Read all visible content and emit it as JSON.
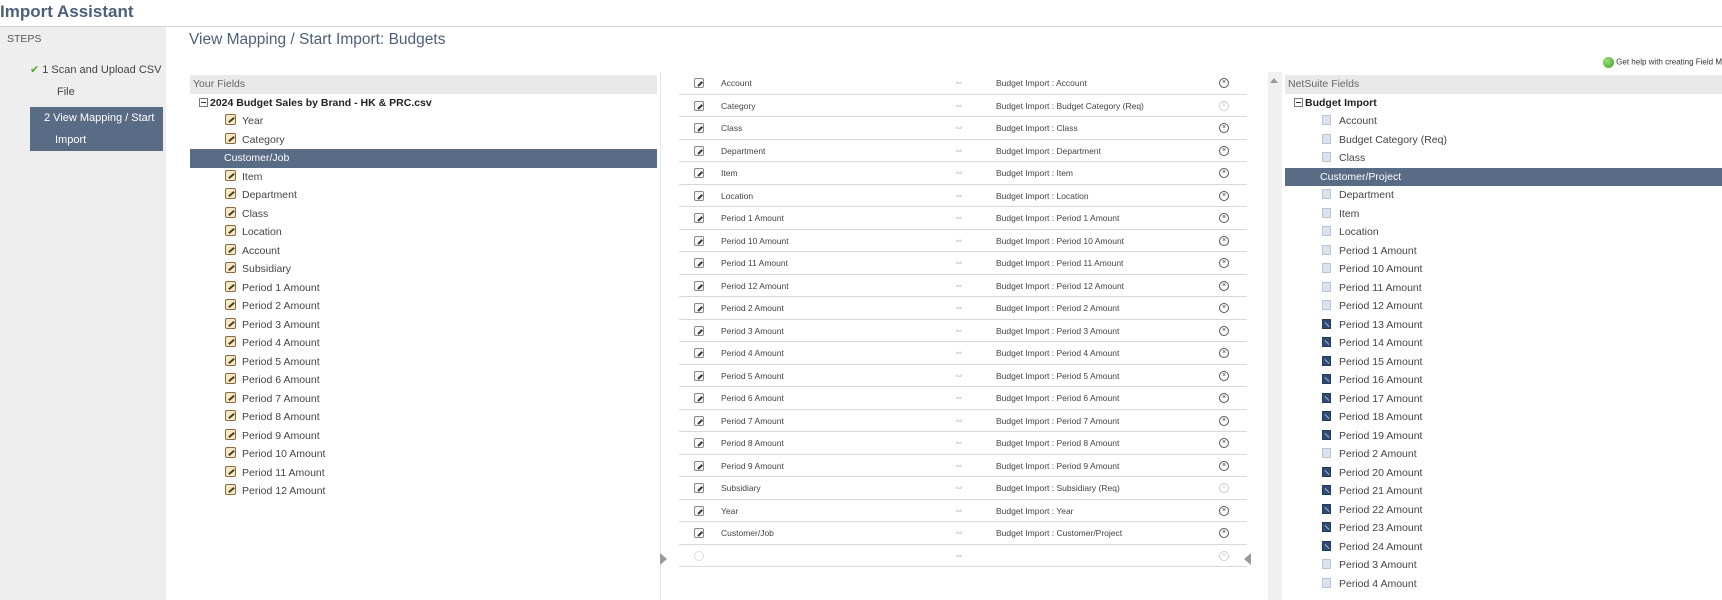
{
  "app": {
    "title": "Import Assistant"
  },
  "steps": {
    "label": "STEPS",
    "step1": {
      "line1": "1 Scan and Upload CSV",
      "line2": "File",
      "done_mark": "✔"
    },
    "step2": {
      "line1": "2 View Mapping / Start",
      "line2": "Import"
    }
  },
  "section_title": "View Mapping / Start Import: Budgets",
  "help_link": "Get help with creating Field M",
  "your_fields": {
    "header": "Your Fields",
    "root": "2024 Budget Sales by Brand - HK & PRC.csv",
    "items": [
      {
        "label": "Year"
      },
      {
        "label": "Category"
      },
      {
        "label": "Customer/Job",
        "selected": true
      },
      {
        "label": "Item"
      },
      {
        "label": "Department"
      },
      {
        "label": "Class"
      },
      {
        "label": "Location"
      },
      {
        "label": "Account"
      },
      {
        "label": "Subsidiary"
      },
      {
        "label": "Period 1 Amount"
      },
      {
        "label": "Period 2 Amount"
      },
      {
        "label": "Period 3 Amount"
      },
      {
        "label": "Period 4 Amount"
      },
      {
        "label": "Period 5 Amount"
      },
      {
        "label": "Period 6 Amount"
      },
      {
        "label": "Period 7 Amount"
      },
      {
        "label": "Period 8 Amount"
      },
      {
        "label": "Period 9 Amount"
      },
      {
        "label": "Period 10 Amount"
      },
      {
        "label": "Period 11 Amount"
      },
      {
        "label": "Period 12 Amount"
      }
    ]
  },
  "mapping": {
    "arrow_glyph": "⇔",
    "delete_glyph": "×",
    "rows": [
      {
        "source": "Account",
        "target": "Budget Import : Account",
        "removable": true
      },
      {
        "source": "Category",
        "target": "Budget Import : Budget Category (Req)",
        "removable": false
      },
      {
        "source": "Class",
        "target": "Budget Import : Class",
        "removable": true
      },
      {
        "source": "Department",
        "target": "Budget Import : Department",
        "removable": true
      },
      {
        "source": "Item",
        "target": "Budget Import : Item",
        "removable": true
      },
      {
        "source": "Location",
        "target": "Budget Import : Location",
        "removable": true
      },
      {
        "source": "Period 1 Amount",
        "target": "Budget Import : Period 1 Amount",
        "removable": true
      },
      {
        "source": "Period 10 Amount",
        "target": "Budget Import : Period 10 Amount",
        "removable": true
      },
      {
        "source": "Period 11 Amount",
        "target": "Budget Import : Period 11 Amount",
        "removable": true
      },
      {
        "source": "Period 12 Amount",
        "target": "Budget Import : Period 12 Amount",
        "removable": true
      },
      {
        "source": "Period 2 Amount",
        "target": "Budget Import : Period 2 Amount",
        "removable": true
      },
      {
        "source": "Period 3 Amount",
        "target": "Budget Import : Period 3 Amount",
        "removable": true
      },
      {
        "source": "Period 4 Amount",
        "target": "Budget Import : Period 4 Amount",
        "removable": true
      },
      {
        "source": "Period 5 Amount",
        "target": "Budget Import : Period 5 Amount",
        "removable": true
      },
      {
        "source": "Period 6 Amount",
        "target": "Budget Import : Period 6 Amount",
        "removable": true
      },
      {
        "source": "Period 7 Amount",
        "target": "Budget Import : Period 7 Amount",
        "removable": true
      },
      {
        "source": "Period 8 Amount",
        "target": "Budget Import : Period 8 Amount",
        "removable": true
      },
      {
        "source": "Period 9 Amount",
        "target": "Budget Import : Period 9 Amount",
        "removable": true
      },
      {
        "source": "Subsidiary",
        "target": "Budget Import : Subsidiary (Req)",
        "removable": false
      },
      {
        "source": "Year",
        "target": "Budget Import : Year",
        "removable": true
      },
      {
        "source": "Customer/Job",
        "target": "Budget Import : Customer/Project",
        "removable": true
      },
      {
        "source": "",
        "target": "",
        "removable": false,
        "empty": true
      }
    ]
  },
  "netsuite_fields": {
    "header": "NetSuite Fields",
    "root": "Budget Import",
    "items": [
      {
        "label": "Account",
        "mapped": false
      },
      {
        "label": "Budget Category (Req)",
        "mapped": false
      },
      {
        "label": "Class",
        "mapped": false
      },
      {
        "label": "Customer/Project",
        "mapped": false,
        "selected": true
      },
      {
        "label": "Department",
        "mapped": false
      },
      {
        "label": "Item",
        "mapped": false
      },
      {
        "label": "Location",
        "mapped": false
      },
      {
        "label": "Period 1 Amount",
        "mapped": false
      },
      {
        "label": "Period 10 Amount",
        "mapped": false
      },
      {
        "label": "Period 11 Amount",
        "mapped": false
      },
      {
        "label": "Period 12 Amount",
        "mapped": false
      },
      {
        "label": "Period 13 Amount",
        "mapped": true
      },
      {
        "label": "Period 14 Amount",
        "mapped": true
      },
      {
        "label": "Period 15 Amount",
        "mapped": true
      },
      {
        "label": "Period 16 Amount",
        "mapped": true
      },
      {
        "label": "Period 17 Amount",
        "mapped": true
      },
      {
        "label": "Period 18 Amount",
        "mapped": true
      },
      {
        "label": "Period 19 Amount",
        "mapped": true
      },
      {
        "label": "Period 2 Amount",
        "mapped": false
      },
      {
        "label": "Period 20 Amount",
        "mapped": true
      },
      {
        "label": "Period 21 Amount",
        "mapped": true
      },
      {
        "label": "Period 22 Amount",
        "mapped": true
      },
      {
        "label": "Period 23 Amount",
        "mapped": true
      },
      {
        "label": "Period 24 Amount",
        "mapped": true
      },
      {
        "label": "Period 3 Amount",
        "mapped": false
      },
      {
        "label": "Period 4 Amount",
        "mapped": false
      }
    ]
  },
  "colors": {
    "selected_bg": "#5a6b86",
    "title": "#4d5f79",
    "check": "#4caf2a"
  }
}
